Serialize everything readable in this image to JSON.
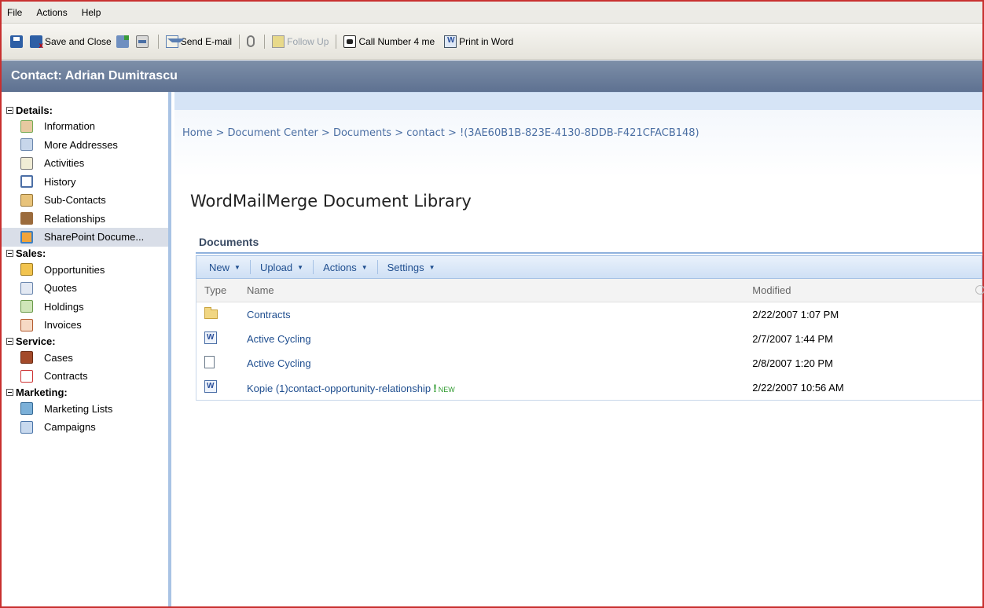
{
  "menubar": {
    "file": "File",
    "actions": "Actions",
    "help": "Help"
  },
  "toolbar": {
    "save_and_close": "Save and Close",
    "send_email": "Send E-mail",
    "follow_up": "Follow Up",
    "call_number": "Call Number 4 me",
    "print_in_word": "Print in Word"
  },
  "header": {
    "title": "Contact: Adrian Dumitrascu"
  },
  "sidebar": {
    "sections": [
      {
        "title": "Details:",
        "items": [
          "Information",
          "More Addresses",
          "Activities",
          "History",
          "Sub-Contacts",
          "Relationships",
          "SharePoint Docume..."
        ]
      },
      {
        "title": "Sales:",
        "items": [
          "Opportunities",
          "Quotes",
          "Holdings",
          "Invoices"
        ]
      },
      {
        "title": "Service:",
        "items": [
          "Cases",
          "Contracts"
        ]
      },
      {
        "title": "Marketing:",
        "items": [
          "Marketing Lists",
          "Campaigns"
        ]
      }
    ],
    "selected": "SharePoint Docume..."
  },
  "main": {
    "breadcrumb": "Home > Document Center > Documents > contact > !(3AE60B1B-823E-4130-8DDB-F421CFACB148)",
    "library_title": "WordMailMerge Document Library",
    "documents_label": "Documents",
    "doc_toolbar": {
      "new": "New",
      "upload": "Upload",
      "actions": "Actions",
      "settings": "Settings"
    },
    "columns": {
      "type": "Type",
      "name": "Name",
      "modified": "Modified"
    },
    "rows": [
      {
        "icon": "folder-icon",
        "name": "Contracts",
        "modified": "2/22/2007 1:07 PM"
      },
      {
        "icon": "word-doc-icon",
        "name": "Active Cycling",
        "modified": "2/7/2007 1:44 PM"
      },
      {
        "icon": "doc-icon",
        "name": "Active Cycling",
        "modified": "2/8/2007 1:20 PM"
      },
      {
        "icon": "word-doc-icon",
        "name": "Kopie (1)contact-opportunity-relationship",
        "modified": "2/22/2007 10:56 AM",
        "new_flag": "!",
        "new_tag": "NEW"
      }
    ]
  },
  "colors": {
    "header_bg": "#6b7e9c",
    "link": "#1f4e8f",
    "window_border": "#c8302f",
    "new_flag": "#2d9a2d"
  }
}
